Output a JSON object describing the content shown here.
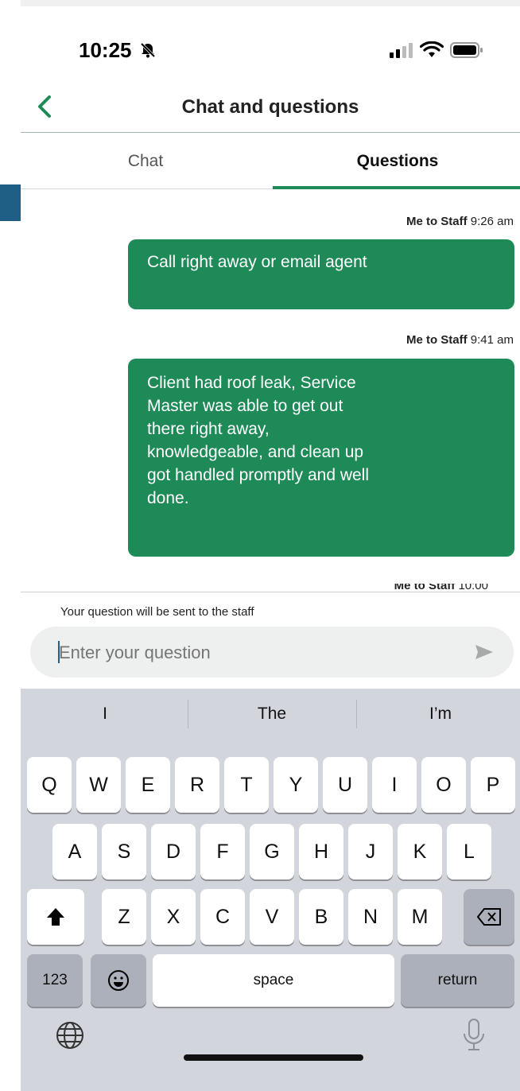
{
  "status": {
    "time": "10:25"
  },
  "nav": {
    "title": "Chat and questions"
  },
  "tabs": [
    {
      "label": "Chat",
      "active": false
    },
    {
      "label": "Questions",
      "active": true
    }
  ],
  "messages": [
    {
      "sender": "Me to Staff",
      "time": "9:26 am",
      "text": "Call right away or email agent"
    },
    {
      "sender": "Me to Staff",
      "time": "9:41 am",
      "text": "Client had roof leak, Service Master was able to get out there right away, knowledgeable, and clean up got handled promptly and well done."
    },
    {
      "sender": "Me to Staff",
      "time": "10:00",
      "partial": true
    }
  ],
  "composer": {
    "note": "Your question will be sent to the staff",
    "placeholder": "Enter your question"
  },
  "keyboard": {
    "suggestions": [
      "I",
      "The",
      "I’m"
    ],
    "row1": [
      "Q",
      "W",
      "E",
      "R",
      "T",
      "Y",
      "U",
      "I",
      "O",
      "P"
    ],
    "row2": [
      "A",
      "S",
      "D",
      "F",
      "G",
      "H",
      "J",
      "K",
      "L"
    ],
    "row3": [
      "Z",
      "X",
      "C",
      "V",
      "B",
      "N",
      "M"
    ],
    "numbers_label": "123",
    "space_label": "space",
    "return_label": "return"
  },
  "colors": {
    "accent": "#1e8a57",
    "keyboard_bg": "#d3d5dc"
  }
}
